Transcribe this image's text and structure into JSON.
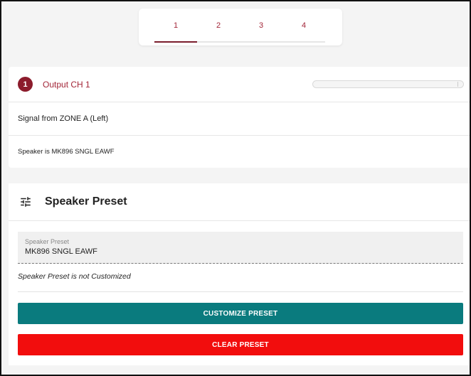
{
  "tabs": [
    {
      "label": "1",
      "active": true
    },
    {
      "label": "2",
      "active": false
    },
    {
      "label": "3",
      "active": false
    },
    {
      "label": "4",
      "active": false
    }
  ],
  "output": {
    "badge": "1",
    "title": "Output CH 1",
    "signal": "Signal from ZONE A (Left)",
    "speaker": "Speaker is MK896 SNGL EAWF"
  },
  "speaker_preset": {
    "title": "Speaker Preset",
    "icon": "tune-icon",
    "field_label": "Speaker Preset",
    "field_value": "MK896 SNGL EAWF",
    "note": "Speaker Preset is not Customized",
    "customize_label": "CUSTOMIZE PRESET",
    "clear_label": "CLEAR PRESET"
  },
  "colors": {
    "accent": "#8c1c2c",
    "tab_text": "#a32638",
    "customize": "#0a7b7e",
    "clear": "#f20d0d"
  }
}
